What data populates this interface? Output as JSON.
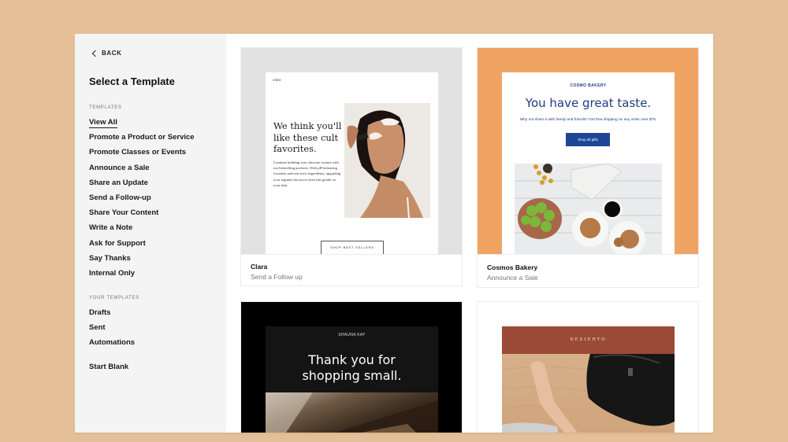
{
  "sidebar": {
    "back_label": "BACK",
    "title": "Select a Template",
    "templates_section_label": "TEMPLATES",
    "templates": [
      {
        "label": "View All",
        "active": true
      },
      {
        "label": "Promote a Product or Service"
      },
      {
        "label": "Promote Classes or Events"
      },
      {
        "label": "Announce a Sale"
      },
      {
        "label": "Share an Update"
      },
      {
        "label": "Send a Follow-up"
      },
      {
        "label": "Share Your Content"
      },
      {
        "label": "Write a Note"
      },
      {
        "label": "Ask for Support"
      },
      {
        "label": "Say Thanks"
      },
      {
        "label": "Internal Only"
      }
    ],
    "your_templates_section_label": "YOUR TEMPLATES",
    "your_templates": [
      {
        "label": "Drafts"
      },
      {
        "label": "Sent"
      },
      {
        "label": "Automations"
      }
    ],
    "start_blank_label": "Start Blank"
  },
  "cards": {
    "clara": {
      "name": "Clara",
      "category": "Send a Follow up",
      "preview": {
        "logo": "clara",
        "headline": "We think you'll like these cult favorites.",
        "body": "Continue building your skincare routine with our bestselling products. With pH balancing formulas and non-toxic ingredients, upgrading your regimen has never been this gentle on your skin.",
        "button": "SHOP BEST SELLERS"
      }
    },
    "cosmos": {
      "name": "Cosmos Bakery",
      "category": "Announce a Sale",
      "preview": {
        "brand": "COSMO BAKERY",
        "headline": "You have great taste.",
        "subtext": "Why not share it with family and friends? Get free shipping on any order over $75.",
        "button": "Shop all gifts"
      }
    },
    "shauna": {
      "preview": {
        "brand": "SHAUNA KAY",
        "headline_line1": "Thank you for",
        "headline_line2": "shopping small."
      }
    },
    "desierto": {
      "preview": {
        "brand": "DESIERTO"
      }
    }
  },
  "colors": {
    "page_background": "#e4bf97",
    "sidebar_background": "#f4f4f4",
    "clara_frame": "#e2e2e2",
    "cosmos_frame": "#f0a463",
    "cosmos_brand_blue": "#1e3c84",
    "cosmos_button": "#1f4597",
    "shauna_frame": "#000000",
    "desierto_band": "#9a4a36"
  }
}
